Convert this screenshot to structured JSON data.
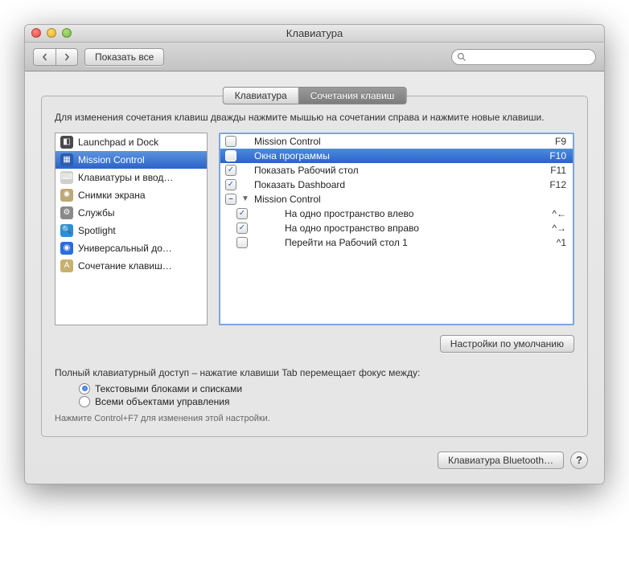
{
  "window": {
    "title": "Клавиатура"
  },
  "toolbar": {
    "show_all_label": "Показать все",
    "search_placeholder": ""
  },
  "tabs": {
    "keyboard": "Клавиатура",
    "shortcuts": "Сочетания клавиш"
  },
  "hint": "Для изменения сочетания клавиш дважды нажмите мышью на сочетании справа и нажмите новые клавиши.",
  "categories": [
    {
      "label": "Launchpad и Dock",
      "icon_bg": "#4a4a4a",
      "icon_glyph": "◧",
      "selected": false
    },
    {
      "label": "Mission Control",
      "icon_bg": "#2a5db0",
      "icon_glyph": "▦",
      "selected": true
    },
    {
      "label": "Клавиатуры и ввод…",
      "icon_bg": "#cfcfcf",
      "icon_glyph": "⌨",
      "selected": false
    },
    {
      "label": "Снимки экрана",
      "icon_bg": "#bda978",
      "icon_glyph": "✺",
      "selected": false
    },
    {
      "label": "Службы",
      "icon_bg": "#8a8a8a",
      "icon_glyph": "⚙",
      "selected": false
    },
    {
      "label": "Spotlight",
      "icon_bg": "#2a8fd8",
      "icon_glyph": "🔍",
      "selected": false
    },
    {
      "label": "Универсальный до…",
      "icon_bg": "#2a6fd8",
      "icon_glyph": "◉",
      "selected": false
    },
    {
      "label": "Сочетание клавиш…",
      "icon_bg": "#c7b070",
      "icon_glyph": "A",
      "selected": false
    }
  ],
  "shortcuts": [
    {
      "checked": false,
      "mixed": false,
      "group": false,
      "indent": 0,
      "label": "Mission Control",
      "shortcut": "F9",
      "selected": false
    },
    {
      "checked": false,
      "mixed": false,
      "group": false,
      "indent": 0,
      "label": "Окна программы",
      "shortcut": "F10",
      "selected": true
    },
    {
      "checked": true,
      "mixed": false,
      "group": false,
      "indent": 0,
      "label": "Показать Рабочий стол",
      "shortcut": "F11",
      "selected": false
    },
    {
      "checked": true,
      "mixed": false,
      "group": false,
      "indent": 0,
      "label": "Показать Dashboard",
      "shortcut": "F12",
      "selected": false
    },
    {
      "checked": false,
      "mixed": true,
      "group": true,
      "indent": 0,
      "label": "Mission Control",
      "shortcut": "",
      "selected": false
    },
    {
      "checked": true,
      "mixed": false,
      "group": false,
      "indent": 1,
      "label": "На одно пространство влево",
      "shortcut": "^←",
      "selected": false
    },
    {
      "checked": true,
      "mixed": false,
      "group": false,
      "indent": 1,
      "label": "На одно пространство вправо",
      "shortcut": "^→",
      "selected": false
    },
    {
      "checked": false,
      "mixed": false,
      "group": false,
      "indent": 1,
      "label": "Перейти на Рабочий стол 1",
      "shortcut": "^1",
      "selected": false
    }
  ],
  "defaults_btn": "Настройки по умолчанию",
  "access": {
    "label": "Полный клавиатурный доступ – нажатие клавиши Tab перемещает фокус между:",
    "opt1": "Текстовыми блоками и списками",
    "opt2": "Всеми объектами управления",
    "hint": "Нажмите Control+F7 для изменения этой настройки."
  },
  "bluetooth_btn": "Клавиатура Bluetooth…",
  "help_glyph": "?"
}
